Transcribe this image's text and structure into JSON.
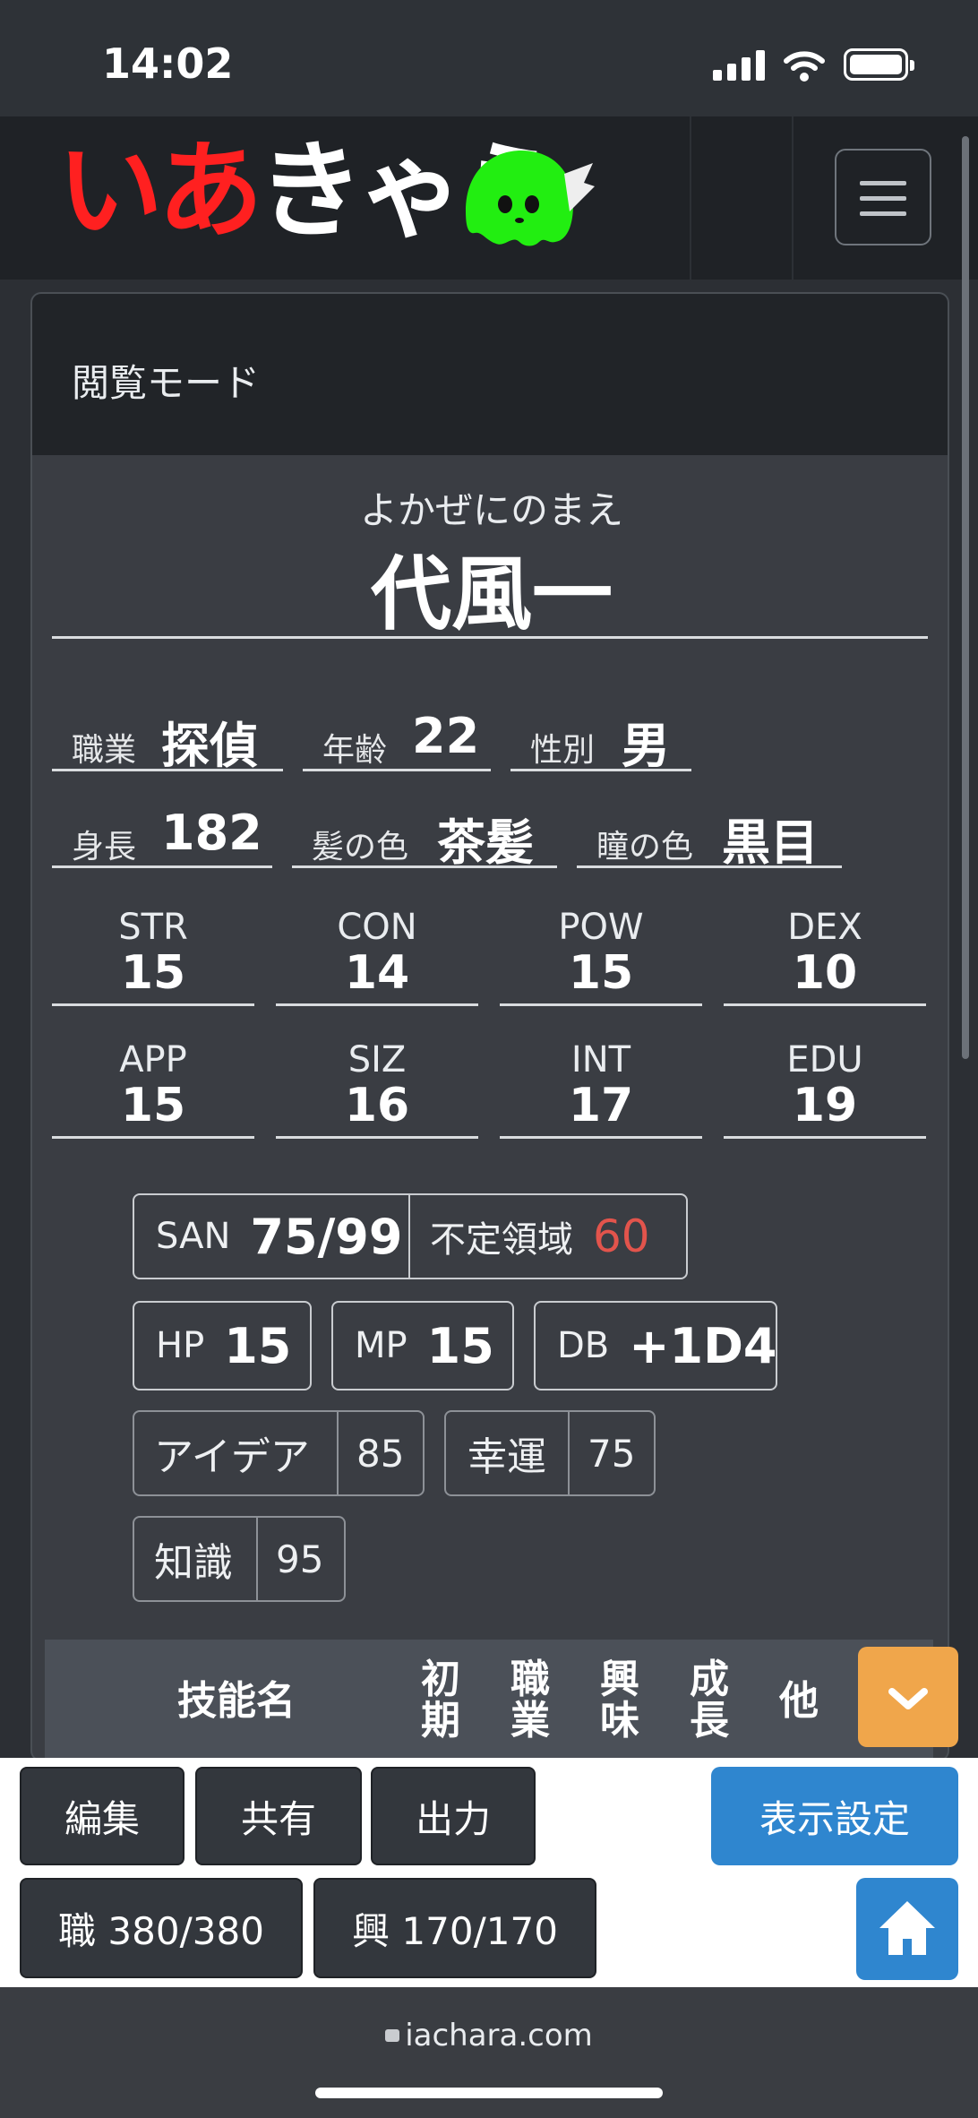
{
  "status_bar": {
    "time": "14:02"
  },
  "header": {
    "logo": {
      "part1": "いあ",
      "part2": "きゃら"
    }
  },
  "view_mode": "閲覧モード",
  "character": {
    "reading": "よかぜにのまえ",
    "name": "代風一",
    "occupation": {
      "label": "職業",
      "value": "探偵"
    },
    "age": {
      "label": "年齢",
      "value": "22"
    },
    "gender": {
      "label": "性別",
      "value": "男"
    },
    "height": {
      "label": "身長",
      "value": "182"
    },
    "hair": {
      "label": "髪の色",
      "value": "茶髪"
    },
    "eyes": {
      "label": "瞳の色",
      "value": "黒目"
    }
  },
  "stats": [
    {
      "name": "STR",
      "value": "15"
    },
    {
      "name": "CON",
      "value": "14"
    },
    {
      "name": "POW",
      "value": "15"
    },
    {
      "name": "DEX",
      "value": "10"
    },
    {
      "name": "APP",
      "value": "15"
    },
    {
      "name": "SIZ",
      "value": "16"
    },
    {
      "name": "INT",
      "value": "17"
    },
    {
      "name": "EDU",
      "value": "19"
    }
  ],
  "san": {
    "label": "SAN",
    "value": "75/99",
    "indef_label": "不定領域",
    "indef_value": "60"
  },
  "hp": {
    "label": "HP",
    "value": "15"
  },
  "mp": {
    "label": "MP",
    "value": "15"
  },
  "db": {
    "label": "DB",
    "value": "+1D4"
  },
  "idea": {
    "label": "アイデア",
    "value": "85"
  },
  "luck": {
    "label": "幸運",
    "value": "75"
  },
  "knowledge": {
    "label": "知識",
    "value": "95"
  },
  "skills_header": {
    "name": "技能名",
    "initial": [
      "初",
      "期"
    ],
    "occupation": [
      "職",
      "業"
    ],
    "interest": [
      "興",
      "味"
    ],
    "growth": [
      "成",
      "長"
    ],
    "other": "他"
  },
  "toolbar": {
    "edit": "編集",
    "share": "共有",
    "output": "出力",
    "display_settings": "表示設定",
    "occ_points": "職 380/380",
    "int_points": "興 170/170"
  },
  "browser": {
    "url": "iachara.com"
  },
  "colors": {
    "logo_red": "#ff2020",
    "logo_green": "#22ee11",
    "accent_blue": "#2f86cf",
    "accent_orange": "#f0a64b",
    "indef_red": "#e2544c"
  }
}
